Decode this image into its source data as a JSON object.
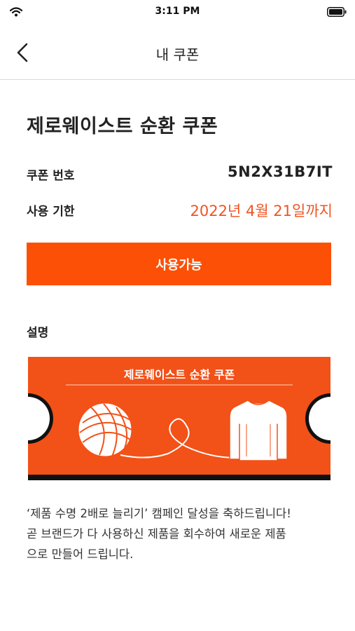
{
  "status_bar": {
    "time": "3:11 PM",
    "wifi_icon": "wifi-icon",
    "battery_icon": "battery-icon"
  },
  "nav": {
    "title": "내 쿠폰",
    "back_icon": "chevron-left-icon"
  },
  "coupon": {
    "title": "제로웨이스트 순환 쿠폰",
    "code_label": "쿠폰 번호",
    "code_value": "5N2X31B7IT",
    "expiry_label": "사용 기한",
    "expiry_value": "2022년 4월 21일까지",
    "button_label": "사용가능"
  },
  "description": {
    "heading": "설명",
    "ticket_title": "제로웨이스트 순환 쿠폰",
    "ticket_icons": [
      "yarn-ball-icon",
      "sweater-icon"
    ],
    "message_lines": [
      "‘제품 수명 2배로 늘리기’ 캠페인 달성을 축하드립니다!",
      "곧 브랜드가 다 사용하신 제품을 회수하여 새로운 제품",
      "으로 만들어 드립니다."
    ]
  },
  "colors": {
    "accent": "#fc5006",
    "ticket": "#f25118",
    "expiry": "#f05423",
    "text": "#222222"
  }
}
